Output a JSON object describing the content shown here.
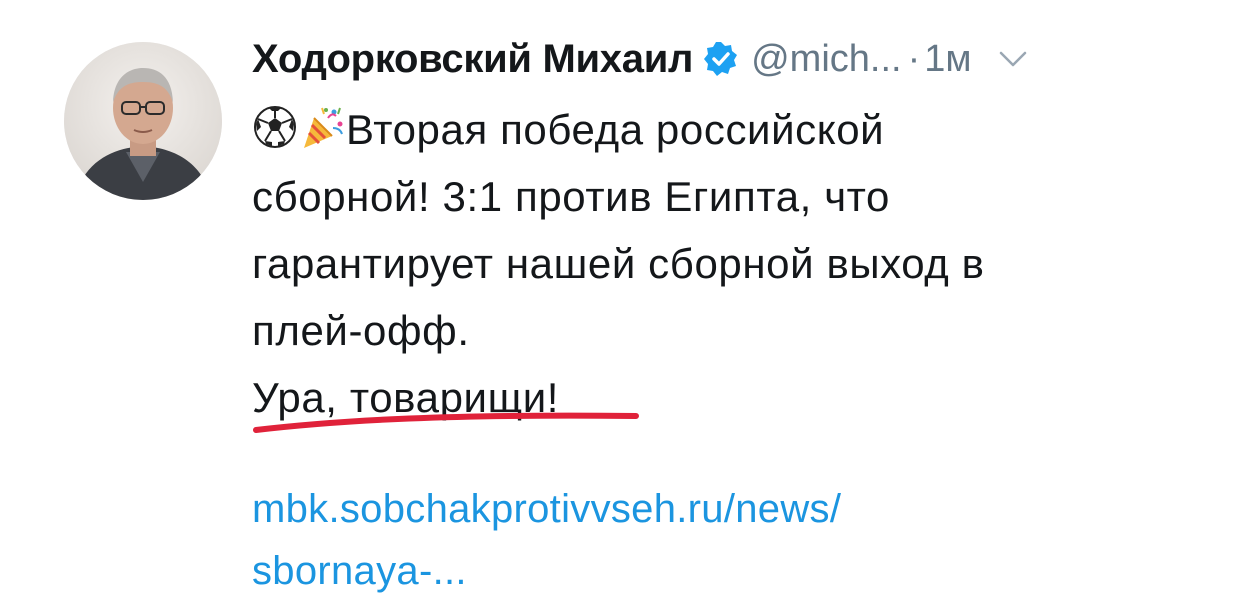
{
  "tweet": {
    "author_name": "Ходорковский Михаил",
    "handle": "@mich...",
    "separator": "·",
    "time": "1м",
    "text_lines": [
      "Вторая победа российской",
      "сборной! 3:1 против Египта, что",
      "гарантирует нашей сборной выход в",
      "плей-офф.",
      "Ура, товарищи!"
    ],
    "link_lines": [
      "mbk.sobchakprotivvseh.ru/news/",
      "sbornaya-..."
    ],
    "emojis": [
      "soccer-ball-icon",
      "party-popper-icon"
    ],
    "icons": {
      "verified": "verified-badge-icon",
      "menu": "chevron-down-icon"
    },
    "colors": {
      "text": "#14171a",
      "muted": "#657786",
      "link": "#1b95e0",
      "verified": "#1da1f2",
      "underline": "#e0223a"
    }
  }
}
